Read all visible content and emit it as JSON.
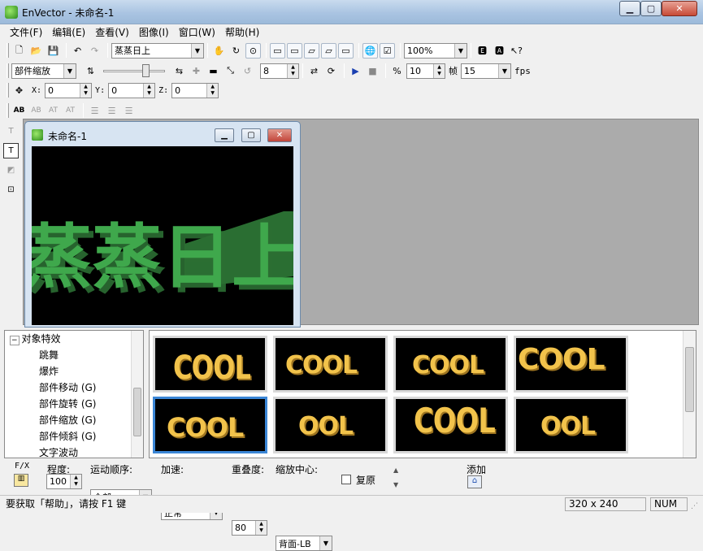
{
  "window": {
    "title": "EnVector - 未命名-1",
    "min": "▁",
    "max": "▢",
    "close": "✕"
  },
  "menu": [
    "文件(F)",
    "编辑(E)",
    "查看(V)",
    "图像(I)",
    "窗口(W)",
    "帮助(H)"
  ],
  "toolbar1": {
    "text_combo": "蒸蒸日上",
    "zoom_combo": "100%"
  },
  "toolbar2": {
    "effect_combo": "部件缩放",
    "frames_value": "8",
    "speed_value": "10",
    "frame_label": "帧",
    "fps_value": "15",
    "fps_label": "fps"
  },
  "toolbar3": {
    "x_label": "X:",
    "x_value": "0",
    "y_label": "Y:",
    "y_value": "0",
    "z_label": "Z:",
    "z_value": "0"
  },
  "child": {
    "title": "未命名-1",
    "canvas_text": "蒸蒸日上",
    "canvas_color": "#3fa84c"
  },
  "tree": {
    "root": "对象特效",
    "items": [
      "跳舞",
      "爆炸",
      "部件移动 (G)",
      "部件旋转 (G)",
      "部件缩放 (G)",
      "部件倾斜 (G)",
      "文字波动"
    ]
  },
  "effects": {
    "thumb_text": [
      "COOL",
      "COOL",
      "COOL",
      "COOL",
      "COOL",
      "OOL",
      "COOL",
      "OOL"
    ]
  },
  "params": {
    "fx_label": "F/X",
    "degree_label": "程度:",
    "degree_value": "100",
    "order_label": "运动顺序:",
    "order_value": "全部",
    "accel_label": "加速:",
    "accel_value": "正常",
    "overlap_label": "重叠度:",
    "overlap_value": "80",
    "center_label": "缩放中心:",
    "center_value": "背面-LB",
    "restore_label": "复原",
    "add_label": "添加"
  },
  "status": {
    "message": "要获取「帮助」，请按 F1 键",
    "size": "320 x 240",
    "num": "NUM"
  },
  "colors": {
    "accent": "#3b86d6",
    "workspace": "#ababab",
    "gold": "#f2c34b"
  }
}
